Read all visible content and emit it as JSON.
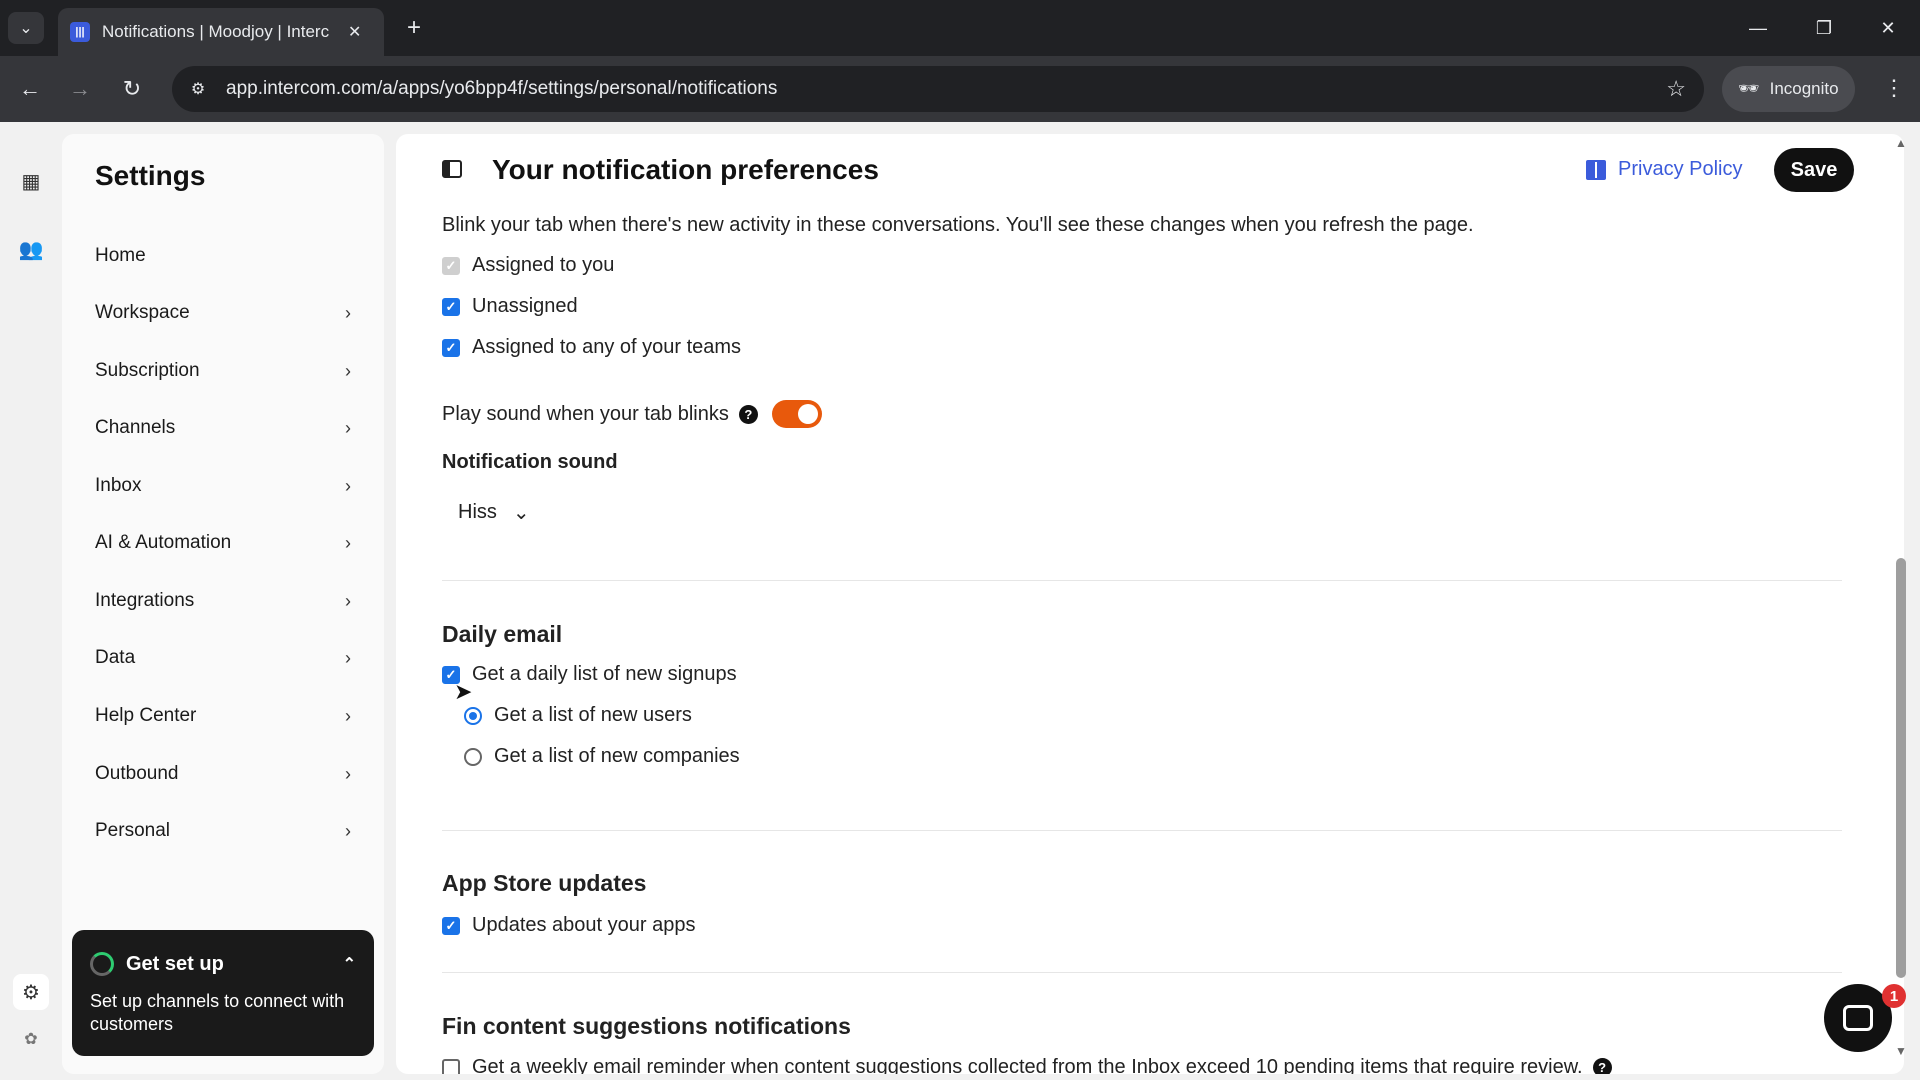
{
  "browser": {
    "tab_title": "Notifications | Moodjoy | Interc",
    "url": "app.intercom.com/a/apps/yo6bpp4f/settings/personal/notifications",
    "incognito_label": "Incognito"
  },
  "settings": {
    "title": "Settings",
    "nav": [
      {
        "label": "Home",
        "has_chevron": false
      },
      {
        "label": "Workspace",
        "has_chevron": true
      },
      {
        "label": "Subscription",
        "has_chevron": true
      },
      {
        "label": "Channels",
        "has_chevron": true
      },
      {
        "label": "Inbox",
        "has_chevron": true
      },
      {
        "label": "AI & Automation",
        "has_chevron": true
      },
      {
        "label": "Integrations",
        "has_chevron": true
      },
      {
        "label": "Data",
        "has_chevron": true
      },
      {
        "label": "Help Center",
        "has_chevron": true
      },
      {
        "label": "Outbound",
        "has_chevron": true
      },
      {
        "label": "Personal",
        "has_chevron": true
      }
    ],
    "setup": {
      "title": "Get set up",
      "text": "Set up channels to connect with customers"
    }
  },
  "main": {
    "title": "Your notification preferences",
    "privacy_label": "Privacy Policy",
    "save_label": "Save",
    "blink_description": "Blink your tab when there's new activity in these conversations. You'll see these changes when you refresh the page.",
    "blink_options": [
      {
        "label": "Assigned to you",
        "checked": true,
        "disabled": true
      },
      {
        "label": "Unassigned",
        "checked": true,
        "disabled": false
      },
      {
        "label": "Assigned to any of your teams",
        "checked": true,
        "disabled": false
      }
    ],
    "play_sound_label": "Play sound when your tab blinks",
    "play_sound_on": true,
    "notification_sound_label": "Notification sound",
    "notification_sound_value": "Hiss",
    "daily_email": {
      "title": "Daily email",
      "checkbox_label": "Get a daily list of new signups",
      "checked": true,
      "radio_users": "Get a list of new users",
      "radio_companies": "Get a list of new companies",
      "selected": "users"
    },
    "app_store": {
      "title": "App Store updates",
      "checkbox_label": "Updates about your apps",
      "checked": true
    },
    "fin": {
      "title": "Fin content suggestions notifications",
      "checkbox_label": "Get a weekly email reminder when content suggestions collected from the Inbox exceed 10 pending items that require review.",
      "checked": false
    }
  },
  "messenger_badge": "1"
}
